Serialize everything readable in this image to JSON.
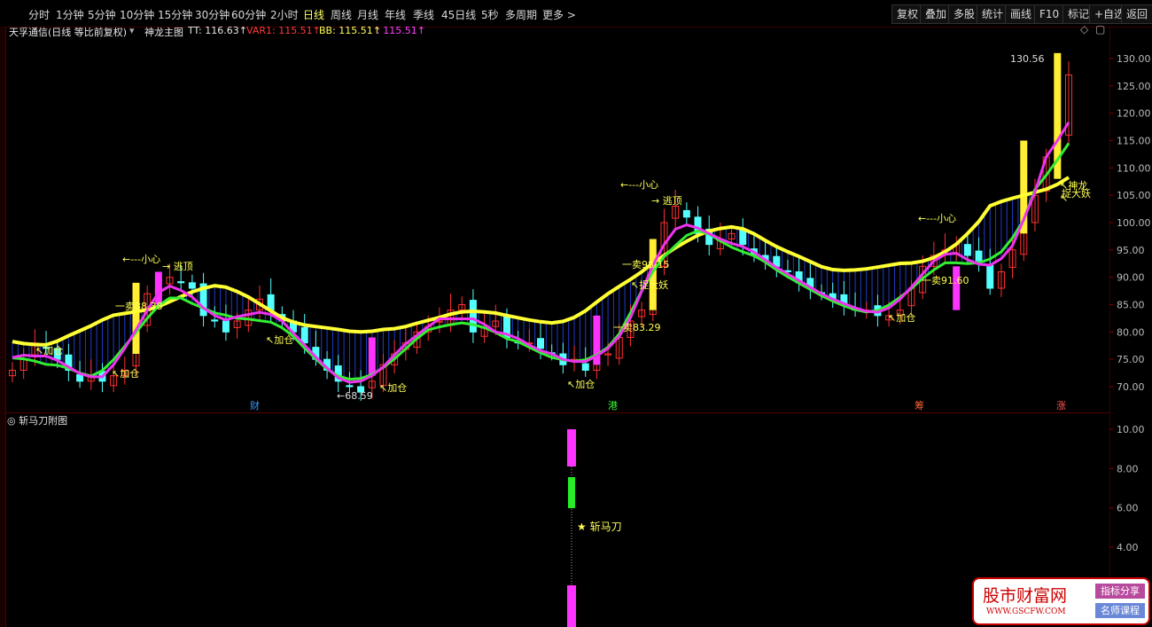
{
  "toolbar": {
    "periods": [
      "分时",
      "1分钟",
      "5分钟",
      "10分钟",
      "15分钟",
      "30分钟",
      "60分钟",
      "2小时",
      "日线",
      "周线",
      "月线",
      "年线",
      "季线",
      "45日线",
      "5秒",
      "多周期",
      "更多 >"
    ],
    "active_period": "日线",
    "right_buttons": [
      "复权",
      "叠加",
      "多股",
      "统计",
      "画线",
      "F10",
      "标记",
      "+自选",
      "返回"
    ]
  },
  "info": {
    "stock": "天孚通信(日线 等比前复权)",
    "indicator": "神龙主图",
    "tt": "TT: 116.63↑",
    "var1": "VAR1: 115.51↑",
    "bb": "BB: 115.51↑",
    "last": ": 115.51↑"
  },
  "sub_panel": {
    "title": "斩马刀附图",
    "signal": "★ 斩马刀"
  },
  "annotations": {
    "jiacang": "加仓",
    "taoding": "逃顶",
    "xiaoxin": "←---小心",
    "sell_88": "一卖88.38",
    "sell_98": "一卖98.15",
    "sell_83": "一卖83.29",
    "sell_91": "一卖91.60",
    "low": "←68.59",
    "high": "130.56",
    "zhuoyao": "捉大妖",
    "shenlong": "神龙",
    "cai": "财",
    "gang": "港",
    "chou": "筹",
    "zhang": "涨"
  },
  "watermark": {
    "title": "股市财富网",
    "url": "WWW.GSCFW.COM",
    "tag1": "指标分享",
    "tag2": "名师课程"
  },
  "chart_data": {
    "type": "candlestick",
    "price_axis": {
      "ticks": [
        130.0,
        125.0,
        120.0,
        115.0,
        110.0,
        105.0,
        100.0,
        95.0,
        90.0,
        85.0,
        80.0,
        75.0,
        70.0
      ]
    },
    "sub_axis": {
      "ticks": [
        10.0,
        8.0,
        6.0,
        4.0
      ]
    },
    "close_points": [
      73,
      75,
      78,
      77,
      75,
      73,
      71,
      72,
      71,
      72,
      73,
      82,
      87,
      88,
      90,
      89,
      88,
      83,
      82,
      80,
      82,
      84,
      86,
      84,
      82,
      80,
      78,
      75,
      73,
      71,
      70,
      69,
      71,
      74,
      76,
      78,
      80,
      81,
      82,
      84,
      85,
      80,
      81,
      82,
      79,
      78,
      78,
      77,
      76,
      74,
      75,
      73,
      75,
      76,
      79,
      82,
      84,
      92,
      100,
      103,
      101,
      98,
      96,
      97,
      98,
      96,
      94,
      93,
      92,
      91,
      89,
      88,
      87,
      86,
      85,
      84,
      84,
      83,
      83,
      84,
      88,
      92,
      94,
      95,
      96,
      94,
      93,
      88,
      91,
      95,
      100,
      105,
      112,
      116,
      127
    ]
  }
}
